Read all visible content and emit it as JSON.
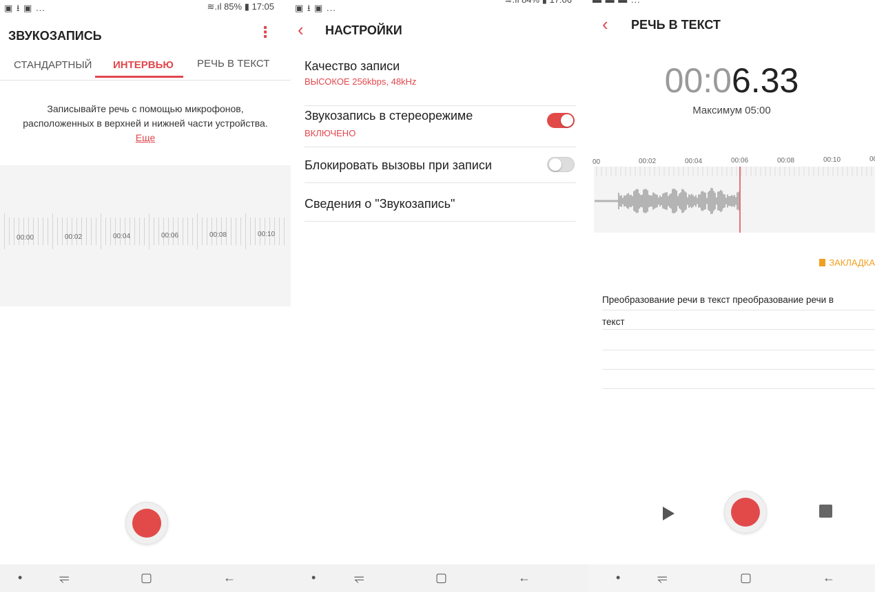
{
  "panel1": {
    "status": {
      "left": "▣ ⭳ ▣ ...",
      "right": "≋.ıl 85% ▮ 17:05"
    },
    "title": "ЗВУКОЗАПИСЬ",
    "menu_icon": "more-vert-icon",
    "tabs": [
      {
        "label": "СТАНДАРТНЫЙ",
        "active": false
      },
      {
        "label": "ИНТЕРВЬЮ",
        "active": true
      },
      {
        "label": "РЕЧЬ В ТЕКСТ",
        "active": false
      }
    ],
    "description": "Записывайте речь с помощью микрофонов, расположенных в верхней и нижней части устройства.",
    "more_link": "Еще",
    "timeline_labels": [
      "00:00",
      "00:02",
      "00:04",
      "00:06",
      "00:08",
      "00:10"
    ],
    "record_button": "record"
  },
  "panel2": {
    "status": {
      "left": "▣ ⭳ ▣ ...",
      "right": "≋.ıl 84% ▮ 17:06"
    },
    "back_icon": "chevron-left-icon",
    "title": "НАСТРОЙКИ",
    "settings": [
      {
        "label": "Качество записи",
        "value": "ВЫСОКОЕ 256kbps, 48kHz"
      },
      {
        "label": "Звукозапись в стереорежиме",
        "value": "ВКЛЮЧЕНО",
        "toggle": true
      },
      {
        "label": "Блокировать вызовы при записи",
        "toggle": false
      },
      {
        "label": "Сведения о \"Звукозапись\""
      }
    ]
  },
  "panel3": {
    "status": {
      "left": "▬ ▬ ▬ ...",
      "right": ""
    },
    "back_icon": "chevron-left-icon",
    "title": "РЕЧЬ В ТЕКСТ",
    "timer_dim": "00:0",
    "timer_bright": "6.33",
    "max_label": "Максимум 05:00",
    "timeline_labels": [
      "00",
      "00:02",
      "00:04",
      "00:06",
      "00:08",
      "00:10",
      "00:"
    ],
    "bookmark_label": "ЗАКЛАДКА",
    "transcript_lines": [
      "Преобразование речи в текст преобразование речи в",
      "текст"
    ]
  },
  "nav_icons": [
    "dot-icon",
    "recent-apps-icon",
    "home-icon",
    "back-arrow-icon"
  ],
  "colors": {
    "accent": "#e0474c",
    "bookmark": "#f0a020",
    "record": "#e24a4a"
  }
}
